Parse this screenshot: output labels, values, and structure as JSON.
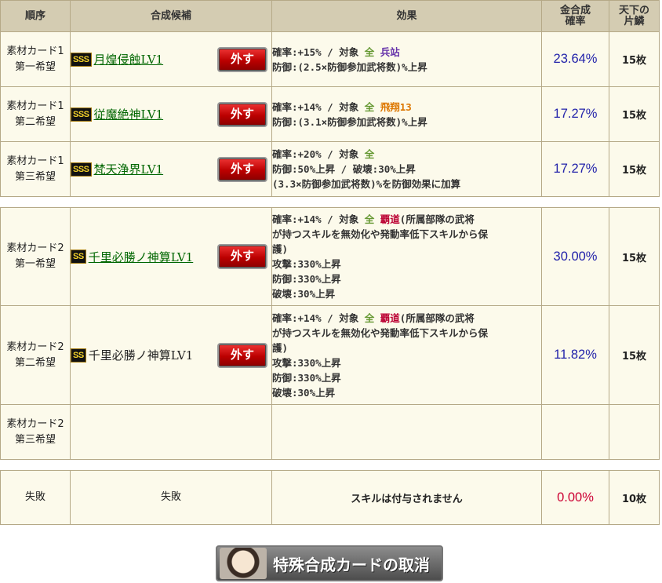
{
  "headers": {
    "order": "順序",
    "candidate": "合成候補",
    "effect": "効果",
    "rate_l1": "金合成",
    "rate_l2": "確率",
    "scale_l1": "天下の",
    "scale_l2": "片鱗"
  },
  "remove_label": "外す",
  "group1": [
    {
      "order_l1": "素材カード1",
      "order_l2": "第一希望",
      "rank": "SSS",
      "skill": "月煌侵蝕LV1",
      "eff_l1_a": "確率:+15% / 対象 ",
      "eff_l1_b": "全",
      "eff_l1_c": "兵站",
      "eff_l2": "防御:(2.5×防御参加武将数)%上昇",
      "rate": "23.64%",
      "count": "15枚"
    },
    {
      "order_l1": "素材カード1",
      "order_l2": "第二希望",
      "rank": "SSS",
      "skill": "従魔絶神LV1",
      "eff_l1_a": "確率:+14% / 対象 ",
      "eff_l1_b": "全",
      "eff_l1_c": "飛翔13",
      "eff_l2": "防御:(3.1×防御参加武将数)%上昇",
      "rate": "17.27%",
      "count": "15枚"
    },
    {
      "order_l1": "素材カード1",
      "order_l2": "第三希望",
      "rank": "SSS",
      "skill": "梵天浄界LV1",
      "eff_l1_a": "確率:+20% / 対象 ",
      "eff_l1_b": "全",
      "eff_l2": "防御:50%上昇 / 破壊:30%上昇",
      "eff_l3": "(3.3×防御参加武将数)%を防御効果に加算",
      "rate": "17.27%",
      "count": "15枚"
    }
  ],
  "group2": [
    {
      "order_l1": "素材カード2",
      "order_l2": "第一希望",
      "rank": "SS",
      "skill": "千里必勝ノ神算LV1",
      "eff_l1_a": "確率:+14% / 対象 ",
      "eff_l1_b": "全",
      "eff_l1_c": "覇道",
      "eff_l1_d": "(所属部隊の武将",
      "eff_l2": "が持つスキルを無効化や発動率低下スキルから保",
      "eff_l3": "護)",
      "eff_l4": "攻撃:330%上昇",
      "eff_l5": "防御:330%上昇",
      "eff_l6": "破壊:30%上昇",
      "rate": "30.00%",
      "count": "15枚"
    },
    {
      "order_l1": "素材カード2",
      "order_l2": "第二希望",
      "rank": "SS",
      "skill": "千里必勝ノ神算LV1",
      "eff_l1_a": "確率:+14% / 対象 ",
      "eff_l1_b": "全",
      "eff_l1_c": "覇道",
      "eff_l1_d": "(所属部隊の武将",
      "eff_l2": "が持つスキルを無効化や発動率低下スキルから保",
      "eff_l3": "護)",
      "eff_l4": "攻撃:330%上昇",
      "eff_l5": "防御:330%上昇",
      "eff_l6": "破壊:30%上昇",
      "rate": "11.82%",
      "count": "15枚"
    },
    {
      "order_l1": "素材カード2",
      "order_l2": "第三希望"
    }
  ],
  "fail": {
    "order": "失敗",
    "candidate": "失敗",
    "effect": "スキルは付与されません",
    "rate": "0.00%",
    "count": "10枚"
  },
  "cancel_button": "特殊合成カードの取消",
  "colors": {
    "header_bg": "#d4ccb2",
    "cell_bg": "#fcfaeb",
    "rate_blue": "#2222aa",
    "rate_red": "#cc0033",
    "link_green": "#006600"
  }
}
